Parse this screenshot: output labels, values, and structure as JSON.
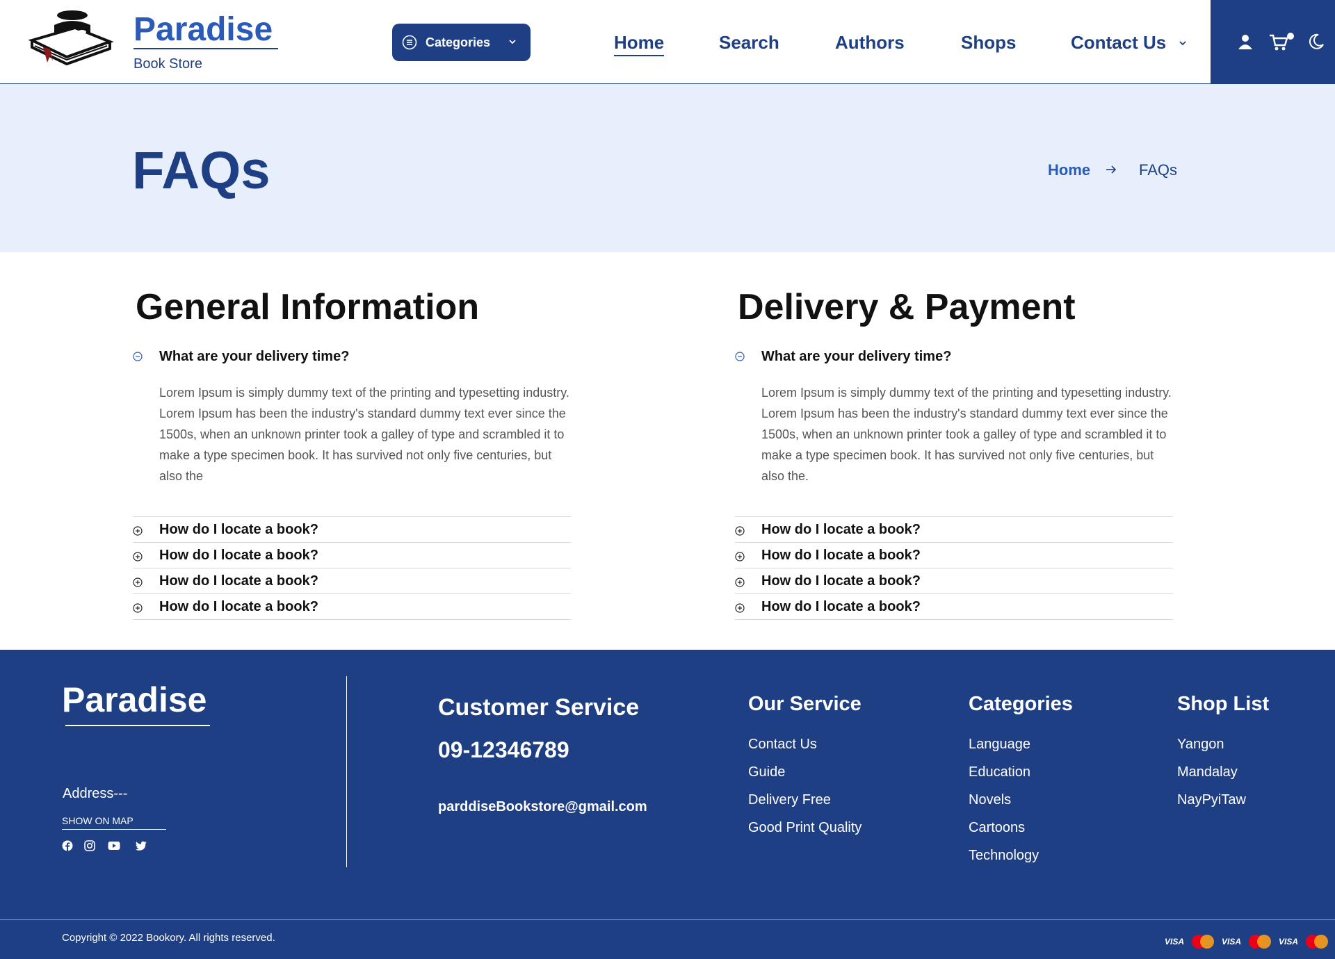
{
  "header": {
    "brand_title": "Paradise",
    "brand_subtitle": "Book Store",
    "categories_label": "Categories",
    "nav": [
      "Home",
      "Search",
      "Authors",
      "Shops",
      "Contact Us"
    ],
    "tool_icons": [
      "user-icon",
      "cart-icon",
      "moon-icon"
    ]
  },
  "hero": {
    "title": "FAQs",
    "breadcrumb": {
      "home": "Home",
      "current": "FAQs"
    }
  },
  "faq": {
    "general": {
      "title": "General Information",
      "open_question": "What are your delivery time?",
      "answer": "Lorem Ipsum is simply dummy text of the printing and typesetting industry. Lorem Ipsum has been the industry's standard dummy text ever since the 1500s, when an unknown printer took a galley of type and scrambled it to make a type specimen book. It has survived not only five centuries, but also the",
      "questions": [
        "How do I locate a book?",
        "How do I locate a book?",
        "How do I locate a book?",
        "How do I locate a book?"
      ]
    },
    "delivery": {
      "title": "Delivery & Payment",
      "open_question": "What are your delivery time?",
      "answer": "Lorem Ipsum is simply dummy text of the printing and typesetting industry. Lorem Ipsum has been the industry's standard dummy text ever since the 1500s, when an unknown printer took a galley of type and scrambled it to make a type specimen book. It has survived not only five centuries, but also the.",
      "questions": [
        "How do I locate a book?",
        "How do I locate a book?",
        "How do I locate a book?",
        "How do I locate a book?"
      ]
    }
  },
  "footer": {
    "brand": "Paradise",
    "address": "Address---",
    "show_on_map": "SHOW ON MAP",
    "social_icons": [
      "facebook-icon",
      "instagram-icon",
      "youtube-icon",
      "twitter-icon"
    ],
    "customer_service": {
      "title": "Customer Service",
      "phone": "09-12346789",
      "email": "parddiseBookstore@gmail.com"
    },
    "our_service": {
      "title": "Our Service",
      "links": [
        "Contact Us",
        "Guide",
        "Delivery Free",
        "Good Print Quality"
      ]
    },
    "categories": {
      "title": "Categories",
      "links": [
        "Language",
        "Education",
        "Novels",
        "Cartoons",
        "Technology"
      ]
    },
    "shop_list": {
      "title": "Shop List",
      "links": [
        "Yangon",
        "Mandalay",
        "NayPyiTaw"
      ]
    },
    "copyright": "Copyright © 2022 Bookory. All rights reserved.",
    "payments": [
      "VISA",
      "MasterCard",
      "VISA",
      "MasterCard",
      "VISA",
      "MasterCard"
    ]
  },
  "colors": {
    "primary": "#1f3f84",
    "accent": "#2a5bb8",
    "hero_bg": "#e8effc"
  }
}
